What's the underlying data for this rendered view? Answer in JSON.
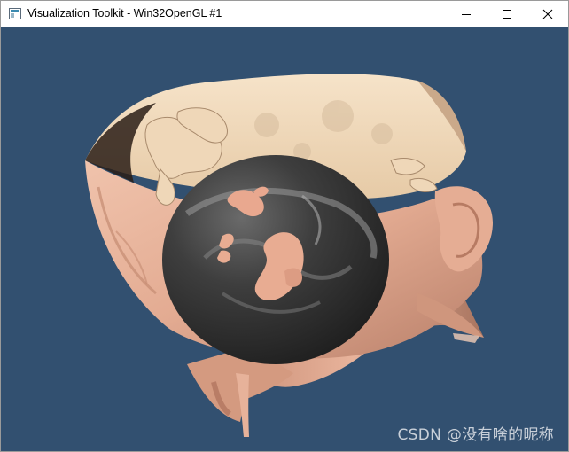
{
  "window": {
    "title": "Visualization Toolkit - Win32OpenGL #1",
    "controls": {
      "minimize_icon": "minimize-icon",
      "maximize_icon": "maximize-icon",
      "close_icon": "close-icon"
    }
  },
  "viewport": {
    "background_color": "#325070",
    "watermark": "CSDN @没有啥的昵称"
  },
  "colors": {
    "skin": "#e7b29a",
    "bone": "#f3dcc0",
    "sphere": "#3b3b3b"
  }
}
